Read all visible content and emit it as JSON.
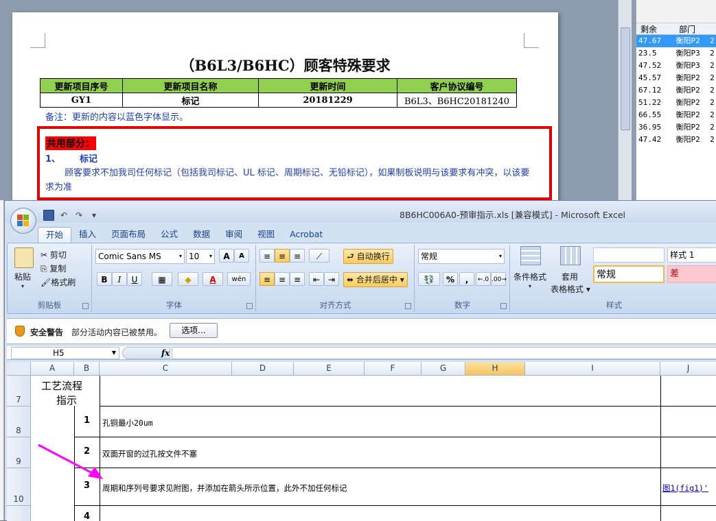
{
  "word_doc": {
    "title": "（B6L3/B6HC）顾客特殊要求",
    "table": {
      "headers": [
        "更新项目序号",
        "更新项目名称",
        "更新时间",
        "客户协议编号"
      ],
      "row": [
        "GY1",
        "标记",
        "20181229",
        "B6L3、B6HC20181240"
      ]
    },
    "note": "备注：更新的内容以蓝色字体显示。",
    "common_label": "共用部分：",
    "section_num": "1、",
    "section_title": "标记",
    "section_text": "顾客要求不加我司任何标记（包括我司标记、UL 标记、周期标记、无铅标记），如果制板说明与该要求有冲突，以该要求为准"
  },
  "side_panel": {
    "headers": [
      "剩余",
      "部门"
    ],
    "rows": [
      {
        "rem": "47.67",
        "dep": "衡阳P2",
        "x": "2",
        "selected": true
      },
      {
        "rem": "23.5",
        "dep": "衡阳P3",
        "x": "2",
        "selected": false
      },
      {
        "rem": "47.52",
        "dep": "衡阳P3",
        "x": "2",
        "selected": false
      },
      {
        "rem": "45.57",
        "dep": "衡阳P2",
        "x": "2",
        "selected": false
      },
      {
        "rem": "67.12",
        "dep": "衡阳P2",
        "x": "2",
        "selected": false
      },
      {
        "rem": "51.22",
        "dep": "衡阳P2",
        "x": "2",
        "selected": false
      },
      {
        "rem": "66.55",
        "dep": "衡阳P2",
        "x": "2",
        "selected": false
      },
      {
        "rem": "36.95",
        "dep": "衡阳P2",
        "x": "2",
        "selected": false
      },
      {
        "rem": "47.42",
        "dep": "衡阳P2",
        "x": "2",
        "selected": false
      }
    ]
  },
  "excel": {
    "window_title": "8B6HC006A0-预审指示.xls  [兼容模式] - Microsoft Excel",
    "tabs": [
      "开始",
      "插入",
      "页面布局",
      "公式",
      "数据",
      "审阅",
      "视图",
      "Acrobat"
    ],
    "clipboard": {
      "paste": "粘贴",
      "cut": "剪切",
      "copy": "复制",
      "format_painter": "格式刷",
      "label": "剪贴板"
    },
    "font": {
      "name": "Comic Sans MS",
      "size": "10",
      "bold": "B",
      "italic": "I",
      "underline": "U",
      "label": "字体",
      "grow": "A",
      "shrink": "A",
      "wen": "wén"
    },
    "alignment": {
      "wrap": "自动换行",
      "merge": "合并后居中",
      "label": "对齐方式"
    },
    "number": {
      "format": "常规",
      "percent": "%",
      "comma": ",",
      "inc_dec": ".0",
      "label": "数字"
    },
    "styles": {
      "cond_format": "条件格式",
      "table_format_1": "套用",
      "table_format_2": "表格格式",
      "style1": "样式 1",
      "normal": "常规",
      "bad": "差",
      "label": "样式"
    },
    "security": {
      "title": "安全警告",
      "message": "部分活动内容已被禁用。",
      "options": "选项..."
    },
    "name_box": "H5",
    "fx": "fx",
    "columns": [
      "A",
      "B",
      "C",
      "D",
      "E",
      "F",
      "G",
      "H",
      "I",
      "J"
    ],
    "rows": [
      {
        "num": "7",
        "a": "工艺流程",
        "a2": "指示",
        "b": "",
        "c": ""
      },
      {
        "num": "8",
        "b": "1",
        "c": "孔铜最小20um"
      },
      {
        "num": "9",
        "b": "2",
        "c": "双面开窗的过孔按文件不塞"
      },
      {
        "num": "10",
        "b": "3",
        "c": "周期和序列号要求见附图，并添加在箭头所示位置，此外不加任何标记",
        "j": "图1(fig1)'"
      },
      {
        "num": "",
        "b": "4",
        "c": ""
      }
    ],
    "colors": {
      "accent": "#ff00ff",
      "selected_col": "#f6c561"
    }
  }
}
